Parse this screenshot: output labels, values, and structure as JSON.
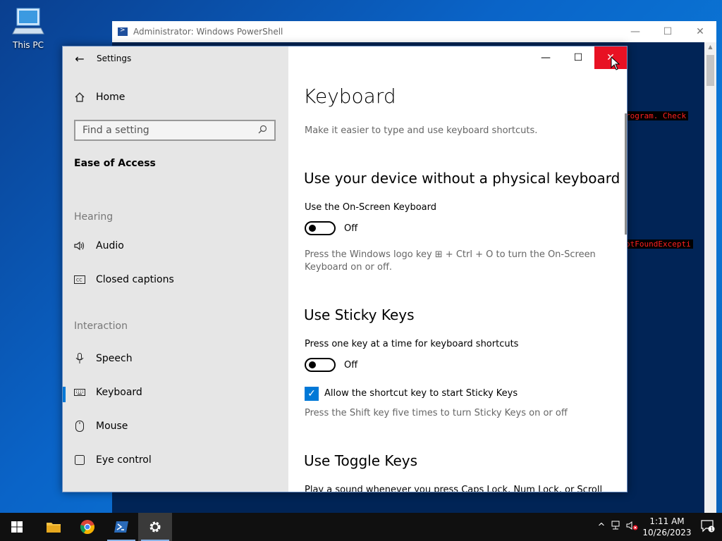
{
  "desktop": {
    "icon_label": "This PC"
  },
  "powershell": {
    "title": "Administrator: Windows PowerShell",
    "line1": "rogram. Check",
    "line2": "otFoundExcepti"
  },
  "settings": {
    "app_title": "Settings",
    "home": "Home",
    "search_placeholder": "Find a setting",
    "category": "Ease of Access",
    "section_hearing": "Hearing",
    "nav_audio": "Audio",
    "nav_captions": "Closed captions",
    "section_interaction": "Interaction",
    "nav_speech": "Speech",
    "nav_keyboard": "Keyboard",
    "nav_mouse": "Mouse",
    "nav_eye": "Eye control"
  },
  "content": {
    "title": "Keyboard",
    "subtitle": "Make it easier to type and use keyboard shortcuts.",
    "osk_heading": "Use your device without a physical keyboard",
    "osk_label": "Use the On-Screen Keyboard",
    "osk_state": "Off",
    "osk_help_1": "Press the Windows logo key ⊞ + Ctrl + O to turn the On-Screen",
    "osk_help_2": "Keyboard on or off.",
    "sticky_heading": "Use Sticky Keys",
    "sticky_label": "Press one key at a time for keyboard shortcuts",
    "sticky_state": "Off",
    "sticky_checkbox": "Allow the shortcut key to start Sticky Keys",
    "sticky_help": "Press the Shift key five times to turn Sticky Keys on or off",
    "toggle_heading": "Use Toggle Keys",
    "toggle_partial": "Play a sound whenever you press Caps Lock, Num Lock, or Scroll"
  },
  "taskbar": {
    "time": "1:11 AM",
    "date": "10/26/2023",
    "notif_count": "1"
  },
  "colors": {
    "accent": "#0078d7",
    "close_red": "#e81123"
  }
}
